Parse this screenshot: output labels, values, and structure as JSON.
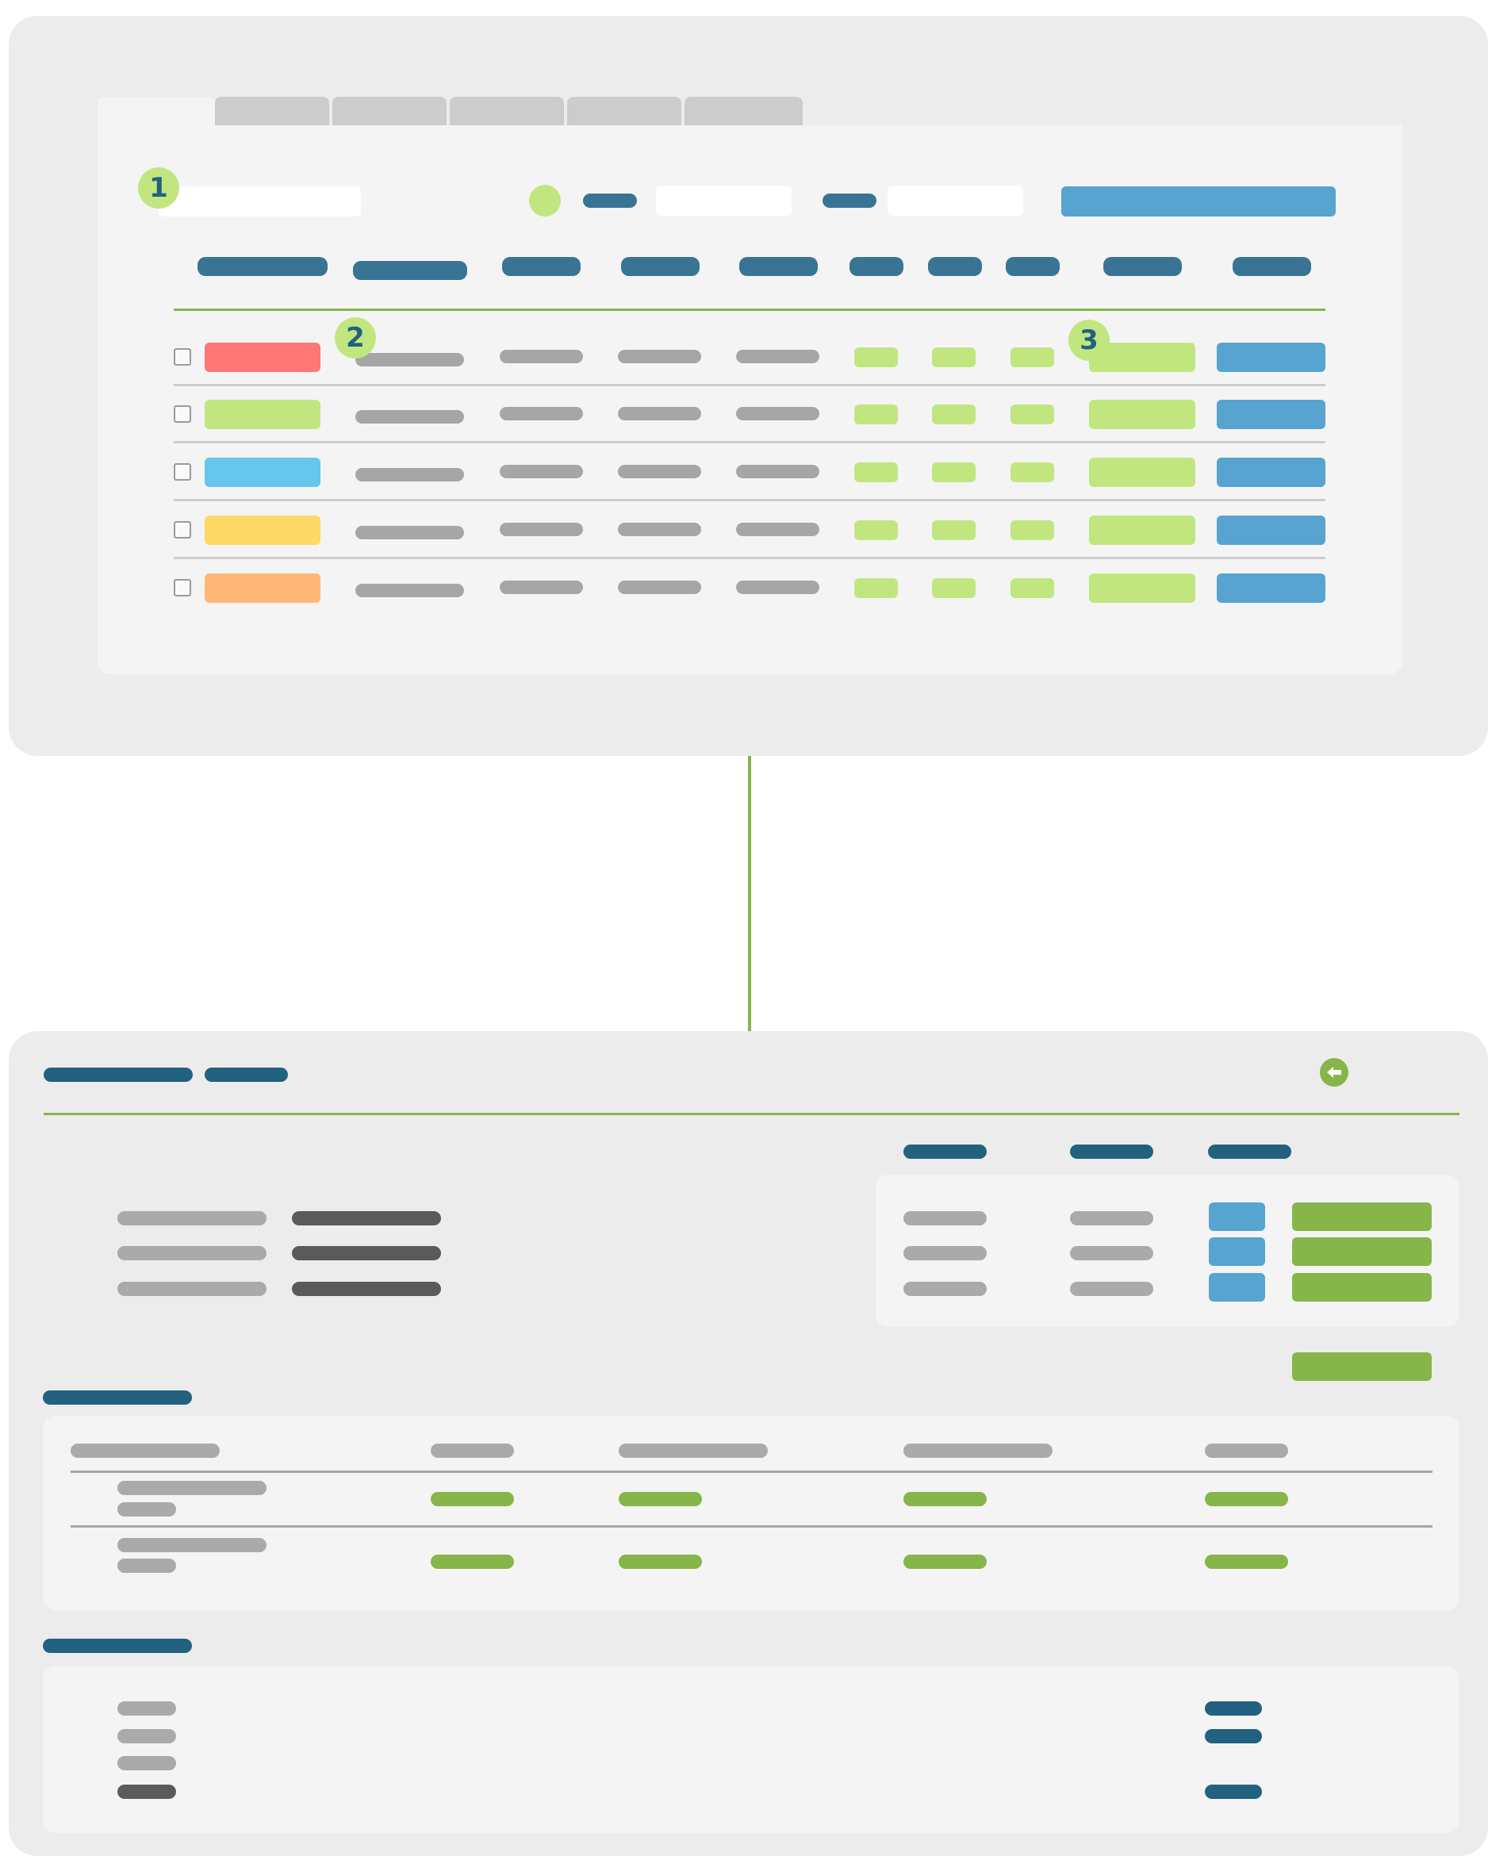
{
  "callouts": [
    "1",
    "2",
    "3"
  ],
  "colors": {
    "panel_bg": "#ececec",
    "card_bg": "#f4f4f4",
    "header_bar": "#3a7494",
    "navy_bar": "#22617f",
    "text_bar": "#a6a6a6",
    "dark_text_bar": "#5a5a5a",
    "light_green": "#c1e680",
    "green": "#86b54a",
    "blue": "#56a4cf",
    "tab": "#cccccc",
    "row_status": [
      "#ff7676",
      "#c1e680",
      "#67c6ec",
      "#ffd966",
      "#ffb777"
    ]
  },
  "icons": {
    "back": "arrow-left-circle-icon"
  },
  "list_screen": {
    "tab_count": 6,
    "column_count": 10,
    "row_count": 5
  },
  "detail_screen": {
    "info_row_count": 3,
    "table_row_count": 2,
    "summary_row_count": 4
  }
}
